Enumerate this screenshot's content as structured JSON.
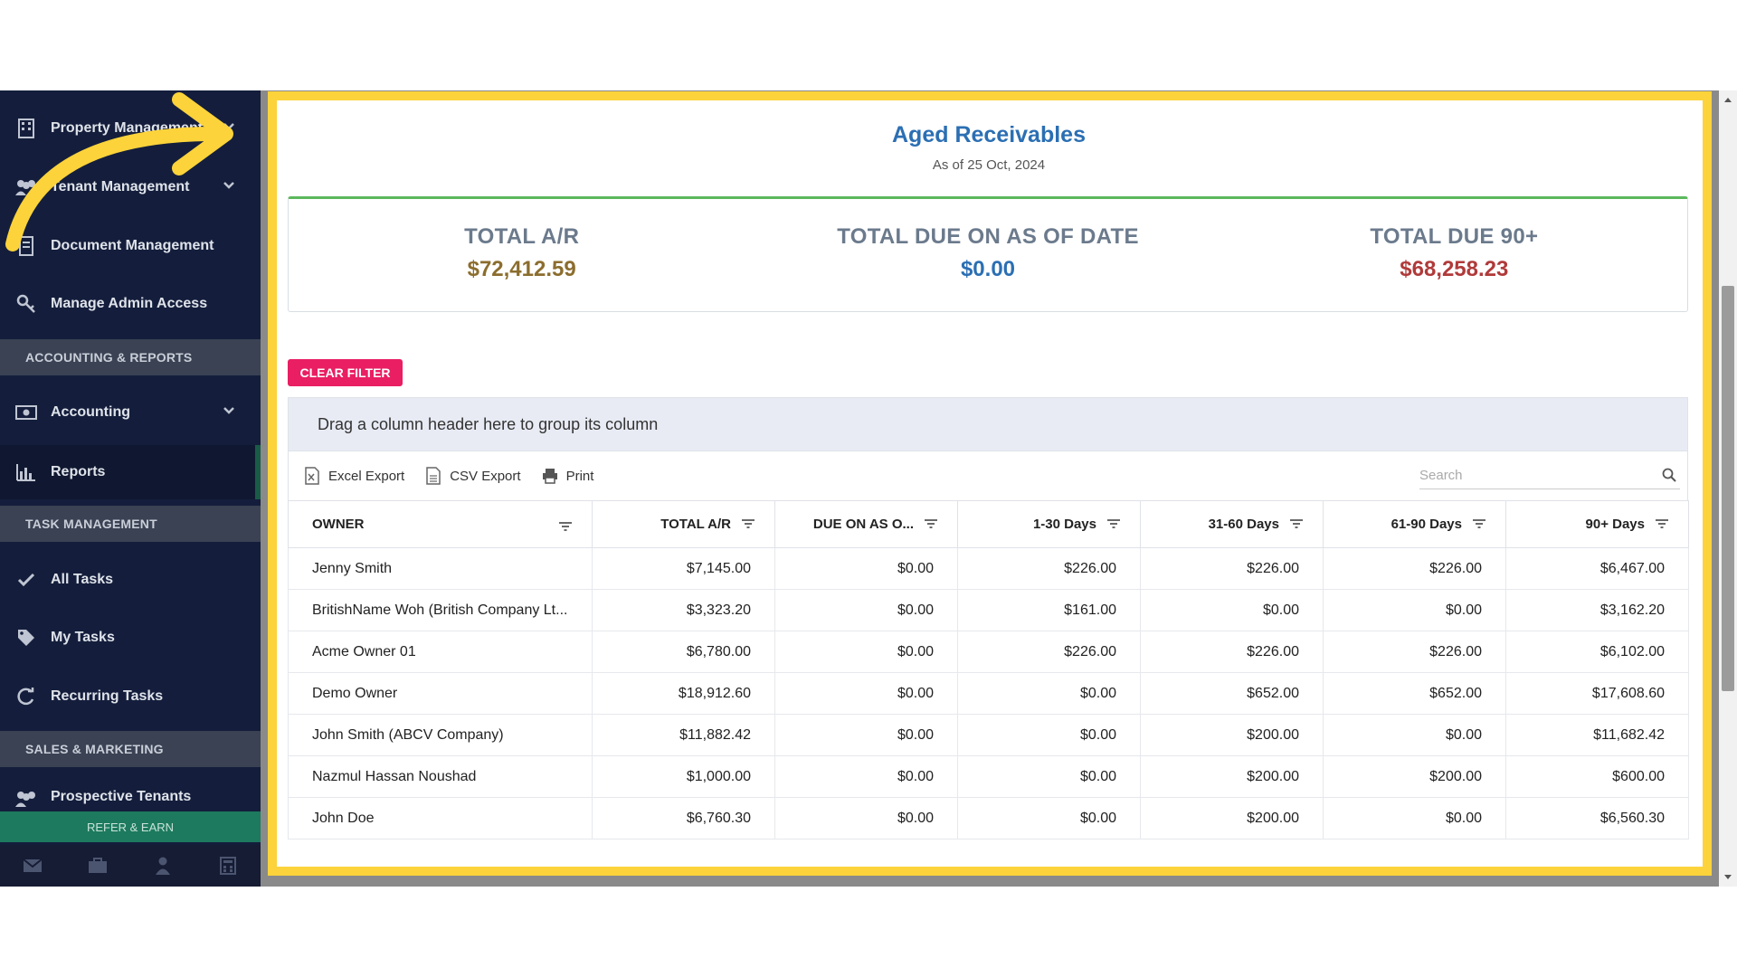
{
  "sidebar": {
    "items": [
      {
        "label": "Property Management",
        "icon": "building-icon",
        "has_chevron": true
      },
      {
        "label": "Tenant Management",
        "icon": "users-icon",
        "has_chevron": true
      },
      {
        "label": "Document Management",
        "icon": "document-icon",
        "has_chevron": false
      },
      {
        "label": "Manage Admin Access",
        "icon": "key-icon",
        "has_chevron": false
      }
    ],
    "section_accounting": "ACCOUNTING & REPORTS",
    "accounting_label": "Accounting",
    "reports_label": "Reports",
    "section_tasks": "TASK MANAGEMENT",
    "all_tasks_label": "All Tasks",
    "my_tasks_label": "My Tasks",
    "recurring_tasks_label": "Recurring Tasks",
    "section_sales": "SALES & MARKETING",
    "prospective_label": "Prospective Tenants",
    "refer_label": "REFER & EARN"
  },
  "report": {
    "title": "Aged Receivables",
    "subtitle": "As of 25 Oct, 2024",
    "total_ar_label": "TOTAL A/R",
    "total_ar_value": "$72,412.59",
    "total_due_label": "TOTAL DUE ON AS OF DATE",
    "total_due_value": "$0.00",
    "total_90_label": "TOTAL DUE 90+",
    "total_90_value": "$68,258.23"
  },
  "clear_filter_label": "CLEAR FILTER",
  "group_panel_text": "Drag a column header here to group its column",
  "toolbar": {
    "excel_label": "Excel Export",
    "csv_label": "CSV Export",
    "print_label": "Print",
    "search_placeholder": "Search"
  },
  "grid": {
    "columns": [
      "OWNER",
      "TOTAL A/R",
      "DUE ON AS O...",
      "1-30 Days",
      "31-60 Days",
      "61-90 Days",
      "90+ Days"
    ],
    "rows": [
      [
        "Jenny Smith",
        "$7,145.00",
        "$0.00",
        "$226.00",
        "$226.00",
        "$226.00",
        "$6,467.00"
      ],
      [
        "BritishName Woh (British Company Lt...",
        "$3,323.20",
        "$0.00",
        "$161.00",
        "$0.00",
        "$0.00",
        "$3,162.20"
      ],
      [
        "Acme Owner 01",
        "$6,780.00",
        "$0.00",
        "$226.00",
        "$226.00",
        "$226.00",
        "$6,102.00"
      ],
      [
        "Demo Owner",
        "$18,912.60",
        "$0.00",
        "$0.00",
        "$652.00",
        "$652.00",
        "$17,608.60"
      ],
      [
        "John Smith (ABCV Company)",
        "$11,882.42",
        "$0.00",
        "$0.00",
        "$200.00",
        "$0.00",
        "$11,682.42"
      ],
      [
        "Nazmul Hassan Noushad",
        "$1,000.00",
        "$0.00",
        "$0.00",
        "$200.00",
        "$200.00",
        "$600.00"
      ],
      [
        "John Doe",
        "$6,760.30",
        "$0.00",
        "$0.00",
        "$200.00",
        "$0.00",
        "$6,560.30"
      ]
    ]
  },
  "colors": {
    "sidebar_bg": "#141e3c",
    "highlight_frame": "#fcd33a",
    "title_blue": "#2b6fb3",
    "ar_gold": "#8b6d2e",
    "due_blue": "#2b6fb3",
    "due90_red": "#b03a3a",
    "clear_filter_pink": "#e91e63",
    "summary_accent_green": "#5cb85c"
  }
}
